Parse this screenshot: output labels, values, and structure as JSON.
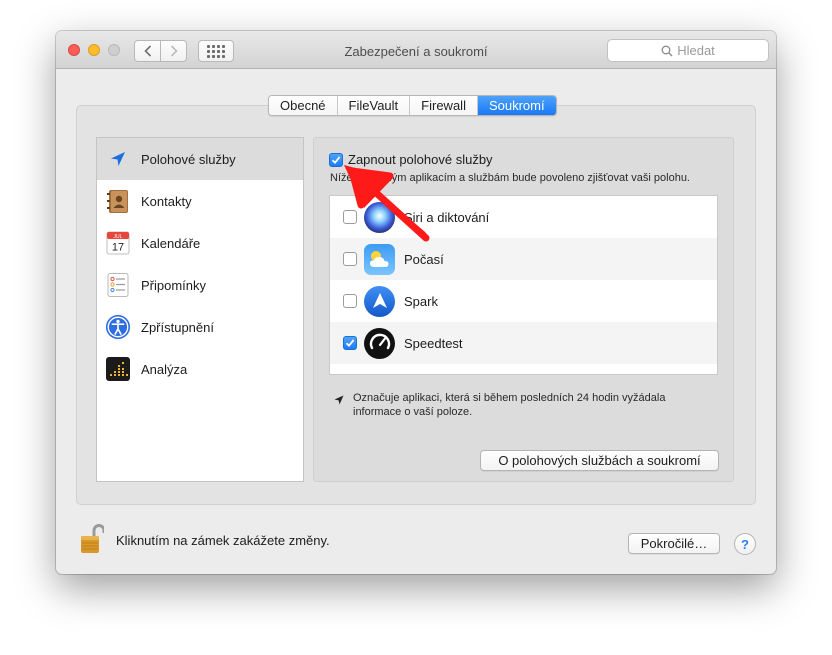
{
  "window": {
    "title": "Zabezpečení a soukromí",
    "search_placeholder": "Hledat"
  },
  "tabs": [
    {
      "label": "Obecné",
      "active": false
    },
    {
      "label": "FileVault",
      "active": false
    },
    {
      "label": "Firewall",
      "active": false
    },
    {
      "label": "Soukromí",
      "active": true
    }
  ],
  "sidebar": {
    "items": [
      {
        "label": "Polohové služby",
        "icon": "location-arrow-icon",
        "selected": true
      },
      {
        "label": "Kontakty",
        "icon": "contacts-book-icon",
        "selected": false
      },
      {
        "label": "Kalendáře",
        "icon": "calendar-icon",
        "selected": false
      },
      {
        "label": "Připomínky",
        "icon": "reminders-icon",
        "selected": false
      },
      {
        "label": "Zpřístupnění",
        "icon": "accessibility-icon",
        "selected": false
      },
      {
        "label": "Analýza",
        "icon": "analytics-icon",
        "selected": false
      }
    ],
    "calendar_month": "JUL",
    "calendar_day": "17"
  },
  "location": {
    "enable_label": "Zapnout polohové služby",
    "enable_checked": true,
    "description": "Níže uvedeným aplikacím a službám bude povoleno zjišťovat vaši polohu.",
    "apps": [
      {
        "name": "Siri a diktování",
        "checked": false,
        "icon": "siri-icon"
      },
      {
        "name": "Počasí",
        "checked": false,
        "icon": "weather-icon"
      },
      {
        "name": "Spark",
        "checked": false,
        "icon": "spark-icon"
      },
      {
        "name": "Speedtest",
        "checked": true,
        "icon": "speedtest-icon"
      }
    ],
    "footnote": "Označuje aplikaci, která si během posledních 24 hodin vyžádala informace o vaší poloze.",
    "about_button": "O polohových službách a soukromí"
  },
  "footer": {
    "lock_text": "Kliknutím na zámek zakážete změny.",
    "advanced_button": "Pokročilé…",
    "help_label": "?"
  },
  "colors": {
    "accent": "#1a78f3",
    "annotation_arrow": "#ff0000"
  }
}
